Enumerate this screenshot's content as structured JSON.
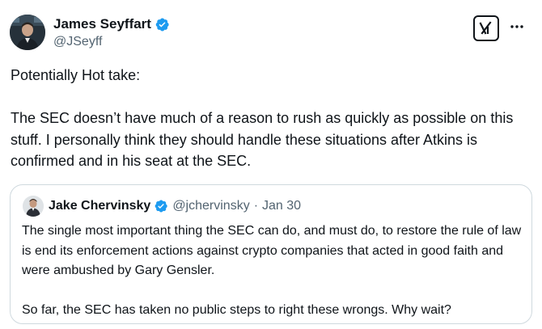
{
  "tweet": {
    "author": {
      "name": "James Seyffart",
      "handle": "@JSeyff",
      "verified": true
    },
    "paragraphs": [
      "Potentially Hot take:",
      "The SEC doesn’t have much of a reason to rush as quickly as possible on this stuff. I personally think they should handle these situations after Atkins is confirmed and in his seat at the SEC."
    ],
    "quoted": {
      "author": {
        "name": "Jake Chervinsky",
        "handle": "@jchervinsky",
        "verified": true
      },
      "separator": "·",
      "date": "Jan 30",
      "paragraphs": [
        "The single most important thing the SEC can do, and must do, to restore the rule of law is end its enforcement actions against crypto companies that acted in good faith and were ambushed by Gary Gensler.",
        "So far, the SEC has taken no public steps to right these wrongs. Why wait?"
      ]
    }
  },
  "icons": {
    "verified": "verified-badge-icon",
    "grok": "grok-logo-icon",
    "more": "more-options-icon"
  },
  "colors": {
    "text": "#0f1419",
    "secondary": "#536471",
    "verified_blue": "#1d9bf0",
    "border": "#cfd9de"
  }
}
